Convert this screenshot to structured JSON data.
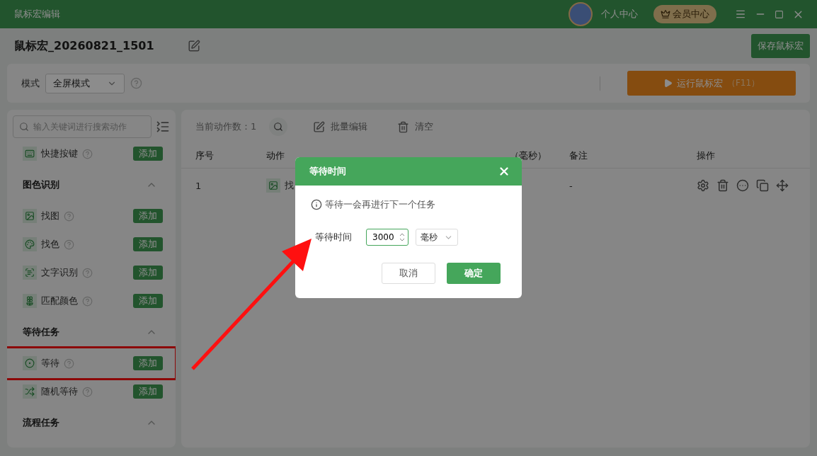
{
  "window": {
    "title": "鼠标宏编辑",
    "user": "个人中心",
    "vip": "会员中心"
  },
  "macro": {
    "name": "鼠标宏_20260821_1501",
    "save": "保存鼠标宏"
  },
  "mode": {
    "label": "模式",
    "value": "全屏模式",
    "run": "运行鼠标宏",
    "run_key": "（F11）"
  },
  "sidebar": {
    "search_placeholder": "输入关键词进行搜索动作",
    "entries": [
      {
        "kind": "item",
        "label": "快捷按键",
        "add": "添加",
        "highlighted": false
      },
      {
        "kind": "section",
        "title": "图色识别",
        "expanded": true
      },
      {
        "kind": "item",
        "label": "找图",
        "add": "添加",
        "highlighted": false
      },
      {
        "kind": "item",
        "label": "找色",
        "add": "添加",
        "highlighted": false
      },
      {
        "kind": "item",
        "label": "文字识别",
        "add": "添加",
        "highlighted": false
      },
      {
        "kind": "item",
        "label": "匹配颜色",
        "add": "添加",
        "highlighted": false
      },
      {
        "kind": "section",
        "title": "等待任务",
        "expanded": true
      },
      {
        "kind": "item",
        "label": "等待",
        "add": "添加",
        "highlighted": true
      },
      {
        "kind": "item",
        "label": "随机等待",
        "add": "添加",
        "highlighted": false
      },
      {
        "kind": "section",
        "title": "流程任务",
        "expanded": true
      }
    ]
  },
  "table": {
    "count": "当前动作数：1",
    "batch_edit": "批量编辑",
    "clear": "清空",
    "columns": [
      "序号",
      "动作",
      "（毫秒）",
      "备注",
      "操作"
    ],
    "rows": [
      {
        "index": "1",
        "action": "找",
        "remark": "-"
      }
    ]
  },
  "dialog": {
    "title": "等待时间",
    "hint": "等待一会再进行下一个任务",
    "field_label": "等待时间",
    "value": "3000",
    "unit": "毫秒",
    "cancel": "取消",
    "confirm": "确定"
  }
}
